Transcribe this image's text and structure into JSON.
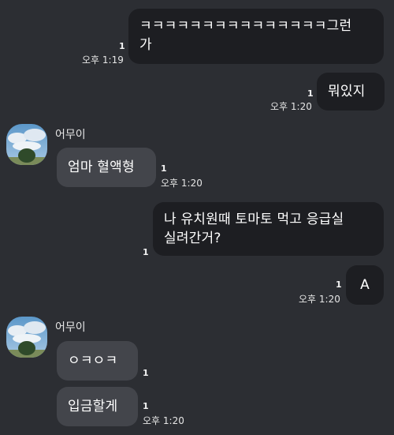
{
  "messages": [
    {
      "text_line1": "ㅋㅋㅋㅋㅋㅋㅋㅋㅋㅋㅋㅋㅋㅋㅋ그런",
      "text_line2": "가",
      "unread": "1",
      "time": "오후 1:19"
    },
    {
      "text": "뭐있지",
      "unread": "1",
      "time": "오후 1:20"
    },
    {
      "sender": "어무이",
      "text": "엄마 혈액형",
      "unread": "1",
      "time": "오후 1:20"
    },
    {
      "text_line1": "나 유치원때 토마토 먹고 응급실",
      "text_line2": "실려간거?",
      "unread": "1"
    },
    {
      "text": "A",
      "unread": "1",
      "time": "오후 1:20"
    },
    {
      "sender": "어무이",
      "text": "ㅇㅋㅇㅋ",
      "unread": "1"
    },
    {
      "text": "입금할게",
      "unread": "1",
      "time": "오후 1:20"
    }
  ],
  "colors": {
    "background": "#2c2e33",
    "sent_bubble": "#1d1e22",
    "received_bubble": "#43454b"
  },
  "icons": {
    "avatar": "profile-photo-sky-tree"
  }
}
